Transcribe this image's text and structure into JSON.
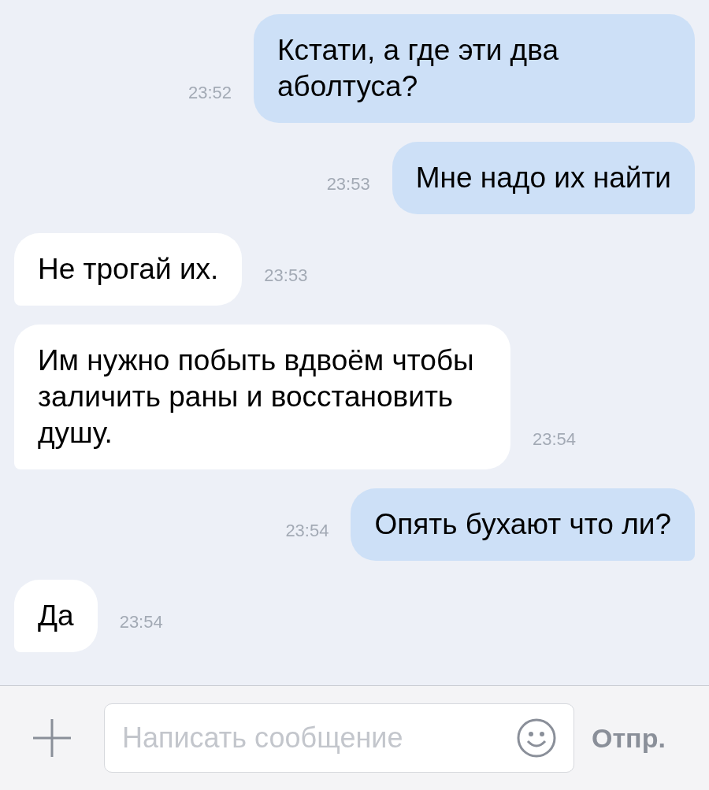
{
  "messages": [
    {
      "kind": "outgoing",
      "text": "Кстати, а где эти два аболтуса?",
      "time": "23:52"
    },
    {
      "kind": "outgoing",
      "text": "Мне надо их найти",
      "time": "23:53"
    },
    {
      "kind": "incoming",
      "text": "Не трогай их.",
      "time": "23:53"
    },
    {
      "kind": "incoming",
      "text": "Им нужно побыть вдвоём чтобы заличить раны и восстановить душу.",
      "time": "23:54"
    },
    {
      "kind": "outgoing",
      "text": "Опять бухают что ли?",
      "time": "23:54"
    },
    {
      "kind": "incoming",
      "text": "Да",
      "time": "23:54"
    }
  ],
  "composer": {
    "placeholder": "Написать сообщение",
    "send_label": "Отпр."
  }
}
